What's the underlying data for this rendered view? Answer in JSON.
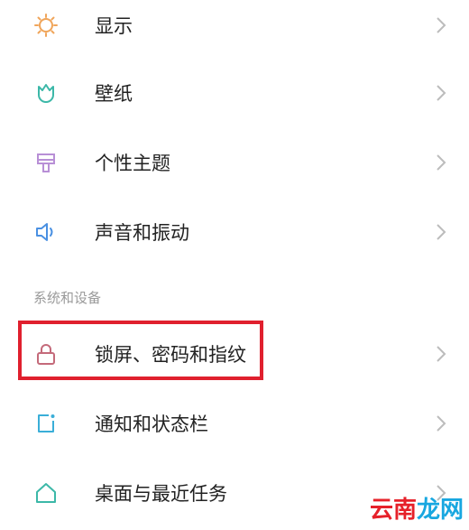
{
  "colors": {
    "display_icon": "#f0a55a",
    "wallpaper_icon": "#3cb8a8",
    "theme_icon": "#b88fd6",
    "sound_icon": "#4a90e2",
    "lock_icon": "#c46a7a",
    "notify_icon": "#3aaed8",
    "home_icon": "#3cb8a8",
    "chevron": "#bcbcbc",
    "highlight": "#e0202e"
  },
  "settings": {
    "items": [
      {
        "label": "显示",
        "icon": "sun-icon"
      },
      {
        "label": "壁纸",
        "icon": "tulip-icon"
      },
      {
        "label": "个性主题",
        "icon": "brush-icon"
      },
      {
        "label": "声音和振动",
        "icon": "speaker-icon"
      }
    ],
    "section_title": "系统和设备",
    "system_items": [
      {
        "label": "锁屏、密码和指纹",
        "icon": "lock-icon"
      },
      {
        "label": "通知和状态栏",
        "icon": "notification-icon"
      },
      {
        "label": "桌面与最近任务",
        "icon": "home-icon"
      }
    ]
  },
  "watermark": {
    "chars": [
      "云",
      "南",
      "龙",
      "网"
    ]
  }
}
